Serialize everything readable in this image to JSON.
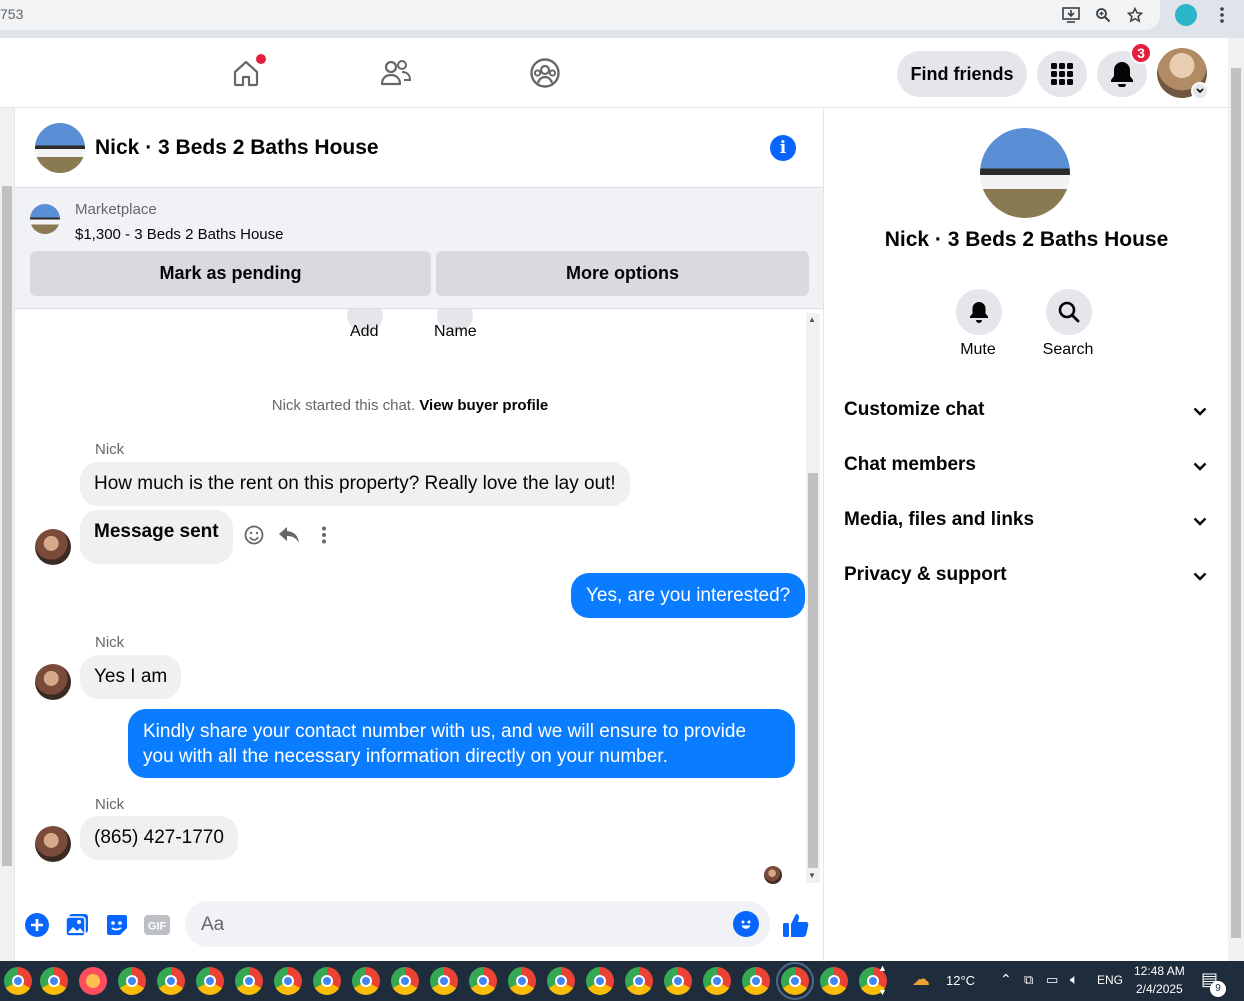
{
  "browser": {
    "url_fragment": "753"
  },
  "header": {
    "find_friends_label": "Find friends",
    "notification_count": "3"
  },
  "chat": {
    "title": "Nick · 3 Beds 2 Baths House",
    "marketplace": {
      "label": "Marketplace",
      "listing": "$1,300 - 3 Beds 2 Baths House",
      "mark_pending_label": "Mark as pending",
      "more_options_label": "More options"
    },
    "top_actions": {
      "add_label": "Add",
      "name_label": "Name"
    },
    "system_text": "Nick started this chat.",
    "system_link": "View buyer profile",
    "messages": [
      {
        "sender": "Nick",
        "text": "How much is the rent on this property? Really love the lay out!"
      },
      {
        "text": "Message sent"
      },
      {
        "text": "Yes, are you interested?"
      },
      {
        "sender": "Nick",
        "text": "Yes I am"
      },
      {
        "text": "Kindly share your contact number with us, and we will ensure to provide you with all the necessary information directly on your number."
      },
      {
        "sender": "Nick",
        "text": "(865) 427-1770"
      }
    ],
    "composer_placeholder": "Aa"
  },
  "right_panel": {
    "title": "Nick · 3 Beds 2 Baths House",
    "mute_label": "Mute",
    "search_label": "Search",
    "sections": [
      "Customize chat",
      "Chat members",
      "Media, files and links",
      "Privacy & support"
    ]
  },
  "taskbar": {
    "temperature": "12°C",
    "language": "ENG",
    "time": "12:48 AM",
    "date": "2/4/2025",
    "notif_count": "9"
  },
  "colors": {
    "accent": "#0866ff",
    "outgoing_bubble": "#0a7cff",
    "badge_red": "#e41e3f"
  }
}
